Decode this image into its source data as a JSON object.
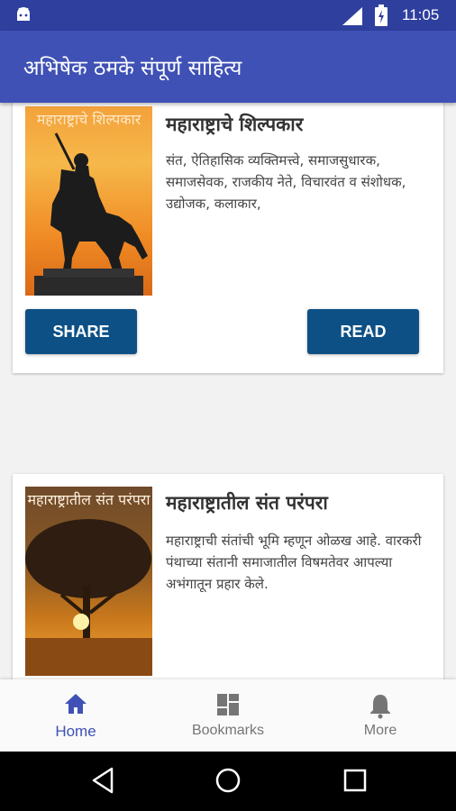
{
  "status_bar": {
    "time": "11:05"
  },
  "app_bar": {
    "title": "अभिषेक ठमके संपूर्ण साहित्य"
  },
  "cards": [
    {
      "cover_text": "महाराष्ट्राचे शिल्पकार",
      "title": "महाराष्ट्राचे शिल्पकार",
      "description": "संत, ऐतिहासिक व्यक्तिमत्त्वे, समाजसुधारक, समाजसेवक, राजकीय नेते, विचारवंत व संशोधक, उद्योजक, कलाकार,",
      "share_label": "SHARE",
      "read_label": "READ"
    },
    {
      "cover_text": "महाराष्ट्रातील संत परंपरा",
      "title": "महाराष्ट्रातील संत परंपरा",
      "description": "महाराष्ट्राची संतांची भूमि म्हणून ओळख आहे. वारकरी पंथाच्या संतानी समाजातील विषमतेवर आपल्या अभंगातून प्रहार केले."
    }
  ],
  "bottom_nav": {
    "items": [
      {
        "label": "Home",
        "icon": "home-icon",
        "active": true
      },
      {
        "label": "Bookmarks",
        "icon": "dashboard-icon",
        "active": false
      },
      {
        "label": "More",
        "icon": "bell-icon",
        "active": false
      }
    ]
  },
  "colors": {
    "status_bar": "#2f3f9e",
    "app_bar": "#3f51b5",
    "button": "#0d5085",
    "nav_active": "#3f51b5",
    "nav_inactive": "#757575"
  }
}
